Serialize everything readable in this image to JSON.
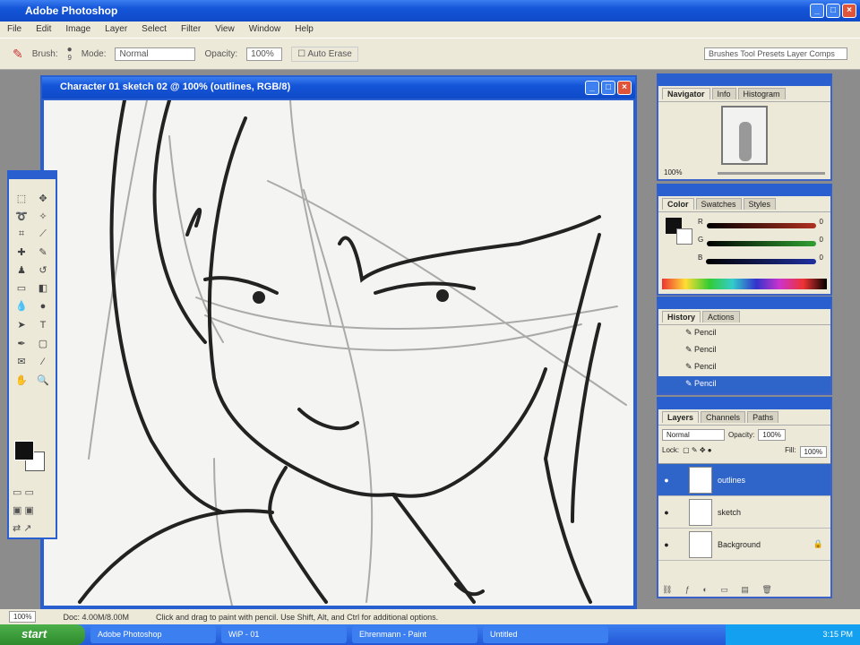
{
  "app": {
    "title": "Adobe Photoshop"
  },
  "menu": [
    "File",
    "Edit",
    "Image",
    "Layer",
    "Select",
    "Filter",
    "View",
    "Window",
    "Help"
  ],
  "options": {
    "brush_label": "Brush:",
    "brush_size": "9",
    "mode_label": "Mode:",
    "mode_value": "Normal",
    "opacity_label": "Opacity:",
    "opacity_value": "100%",
    "auto_erase": "Auto Erase",
    "palette_well": "Brushes Tool Presets Layer Comps"
  },
  "document": {
    "title": "Character 01 sketch 02 @ 100% (outlines, RGB/8)",
    "zoom": "100%",
    "doc_info": "Doc: 4.00M/8.00M"
  },
  "status": {
    "hint": "Click and drag to paint with pencil. Use Shift, Alt, and Ctrl for additional options."
  },
  "navigator": {
    "tabs": [
      "Navigator",
      "Info",
      "Histogram"
    ],
    "zoom": "100%"
  },
  "color": {
    "tabs": [
      "Color",
      "Swatches",
      "Styles"
    ],
    "channels": [
      {
        "label": "R",
        "value": "0"
      },
      {
        "label": "G",
        "value": "0"
      },
      {
        "label": "B",
        "value": "0"
      }
    ],
    "accent_red": "#b03020",
    "accent_green": "#30a030",
    "accent_blue": "#2030a0"
  },
  "history": {
    "tabs": [
      "History",
      "Actions"
    ],
    "items": [
      "Pencil",
      "Pencil",
      "Pencil",
      "Pencil"
    ]
  },
  "layers": {
    "tabs": [
      "Layers",
      "Channels",
      "Paths"
    ],
    "blend": "Normal",
    "opacity_label": "Opacity:",
    "opacity": "100%",
    "lock_label": "Lock:",
    "fill_label": "Fill:",
    "fill": "100%",
    "items": [
      "outlines",
      "sketch",
      "Background"
    ]
  },
  "taskbar": {
    "start": "start",
    "tasks": [
      "Adobe Photoshop",
      "WiP - 01",
      "Ehrenmann - Paint",
      "Untitled"
    ],
    "clock": "3:15 PM"
  }
}
